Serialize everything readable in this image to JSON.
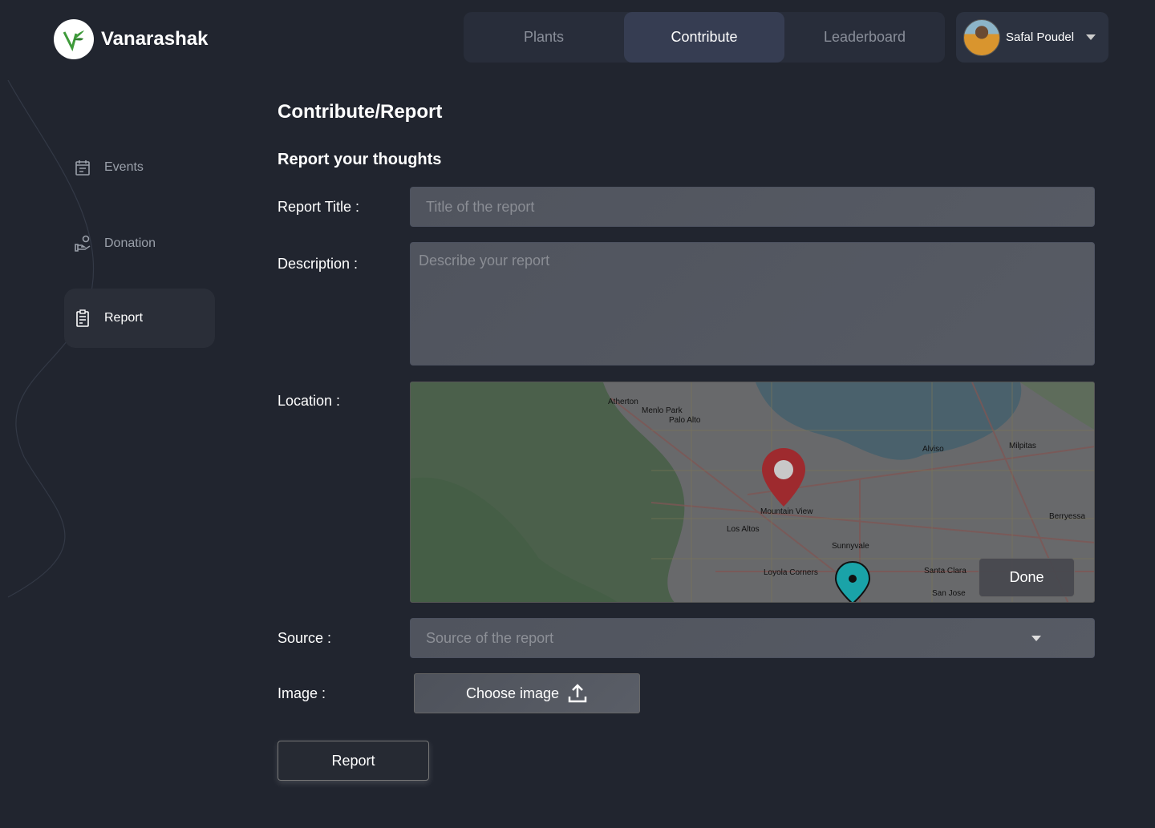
{
  "brand": {
    "name": "Vanarashak"
  },
  "nav": {
    "tabs": [
      {
        "label": "Plants"
      },
      {
        "label": "Contribute",
        "active": true
      },
      {
        "label": "Leaderboard"
      }
    ]
  },
  "user": {
    "name": "Safal Poudel"
  },
  "sidebar": {
    "items": [
      {
        "label": "Events",
        "icon": "calendar-icon"
      },
      {
        "label": "Donation",
        "icon": "donation-hand-icon"
      },
      {
        "label": "Report",
        "icon": "clipboard-icon",
        "active": true
      }
    ]
  },
  "page": {
    "title": "Contribute/Report",
    "subtitle": "Report your thoughts"
  },
  "form": {
    "title_label": "Report Title :",
    "title_placeholder": "Title of the report",
    "title_value": "",
    "description_label": "Description :",
    "description_placeholder": "Describe your report",
    "description_value": "",
    "location_label": "Location :",
    "done_label": "Done",
    "source_label": "Source :",
    "source_placeholder": "Source of the report",
    "image_label": "Image :",
    "choose_image_label": "Choose image",
    "submit_label": "Report"
  },
  "map": {
    "places": [
      "Atherton",
      "Menlo Park",
      "Palo Alto",
      "Mountain View",
      "Los Altos",
      "Sunnyvale",
      "Santa Clara",
      "Milpitas",
      "Alviso",
      "San Jose",
      "Berryessa",
      "Loyola Corners"
    ]
  },
  "colors": {
    "background": "#21252f",
    "active_tab": "#363d52",
    "pin_primary": "#9e2a2e",
    "pin_secondary": "#1aa3a8",
    "logo_green": "#3e9a3a"
  }
}
